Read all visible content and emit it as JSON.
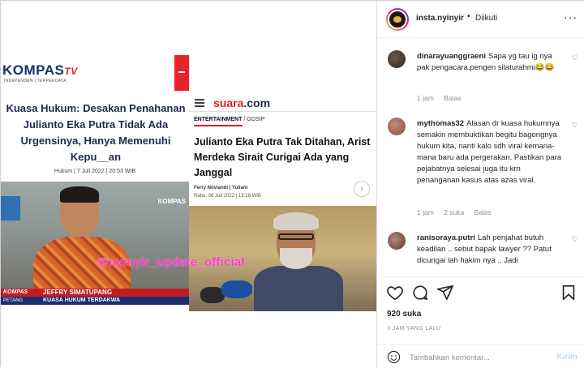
{
  "post_image": {
    "kompas": {
      "logo": "KOMPAS",
      "logo_tv": "TV",
      "tagline": "INDEPENDEN | TERPERCAYA",
      "headline": "Kuasa Hukum: Desakan Penahanan Julianto Eka Putra Tidak Ada Urgensinya, Hanya Memenuhi Kepu__an",
      "meta": "Hukum | 7 Juli 2022 | 20:53 WIB",
      "video_logo": "KOMPAS",
      "lower_third_brand": "KOMPAS",
      "lower_third_brand_sub": "PETANG",
      "lower_third_name": "JEFFRY SIMATUPANG",
      "lower_third_role": "KUASA HUKUM TERDAKWA"
    },
    "suara": {
      "logo": "suara",
      "logo_com": ".com",
      "category_main": "ENTERTAINMENT",
      "category_sub": " / GOSIP",
      "headline": "Julianto Eka Putra Tak Ditahan, Arist Merdeka Sirait Curigai Ada yang Janggal",
      "author": "Ferry Noviandi | Yuliani",
      "date": "Rabu, 06 Juli 2022 | 19:18 WIB"
    },
    "watermark": "@nyinyir_update_official"
  },
  "header": {
    "username": "insta.nyinyir",
    "separator": "•",
    "follow_status": "Diikuti",
    "more": "···"
  },
  "comments": [
    {
      "username": "dinarayuanggraeni",
      "text": "Sapa yg tau ig nya pak pengacara.pengen silaturahmi😂😂",
      "time": "1 jam",
      "likes": "",
      "reply": "Balas"
    },
    {
      "username": "mythomas32",
      "text": "Alasan dr kuasa hukumnya semakin membuktikan begitu bagongnya hukum kita, nanti kalo sdh viral kemana-mana baru ada pergerakan. Pastikan para pejabatnya selesai juga itu krn penanganan kasus atas azas viral.",
      "time": "1 jam",
      "likes": "2 suka",
      "reply": "Balas"
    },
    {
      "username": "ranisoraya.putri",
      "text": "Lah penjahat butuh keadilan .. sebut bapak lawyer ?? Patut dicurigai lah hakim nya .. Jadi",
      "time": "",
      "likes": "",
      "reply": ""
    }
  ],
  "likes_count": "920 suka",
  "time_ago": "3 JAM YANG LALU",
  "comment_input": {
    "placeholder": "Tambahkan komentar...",
    "send": "Kirim"
  },
  "colors": {
    "kompas_red": "#e8232a",
    "kompas_navy": "#1b2e6f",
    "suara_red": "#e21b23",
    "watermark_pink": "#ff35c8",
    "send_disabled": "#b3dbff",
    "muted_text": "#8e8e8e"
  }
}
